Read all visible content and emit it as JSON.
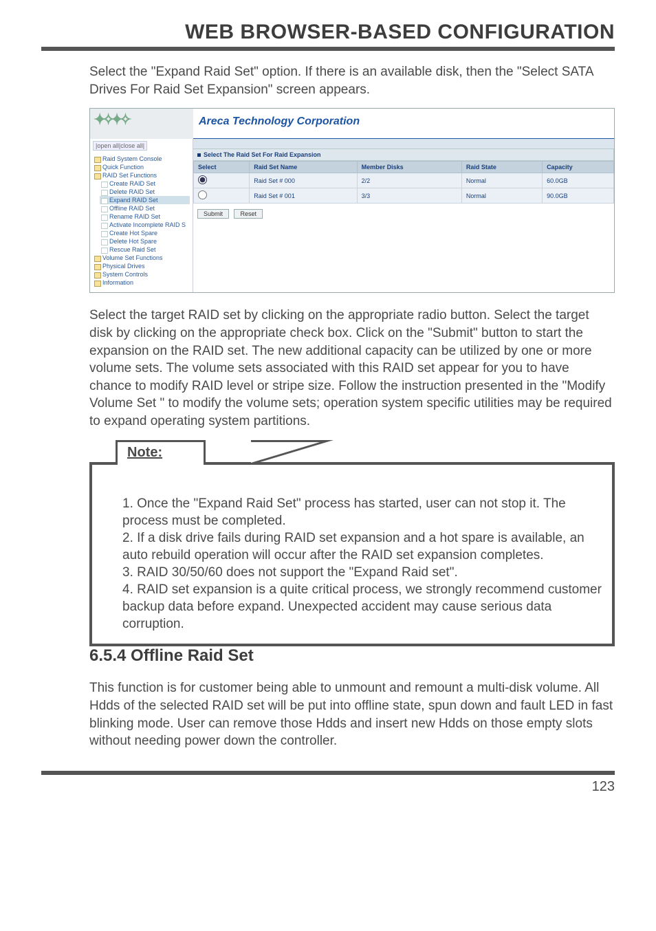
{
  "page_title": "WEB BROWSER-BASED CONFIGURATION",
  "intro_para": "Select the \"Expand Raid Set\" option. If there is an available disk, then the \"Select SATA Drives For Raid Set Expansion\" screen appears.",
  "screenshot": {
    "corp": "Areca Technology Corporation",
    "side_control": "|open all|close all|",
    "tree": {
      "root": "Raid System Console",
      "items": [
        {
          "label": "Quick Function",
          "type": "folder"
        },
        {
          "label": "RAID Set Functions",
          "type": "folder",
          "children": [
            {
              "label": "Create RAID Set",
              "type": "page"
            },
            {
              "label": "Delete RAID Set",
              "type": "page"
            },
            {
              "label": "Expand RAID Set",
              "type": "page",
              "highlight": true
            },
            {
              "label": "Offline RAID Set",
              "type": "page"
            },
            {
              "label": "Rename RAID Set",
              "type": "page"
            },
            {
              "label": "Activate Incomplete RAID S",
              "type": "page"
            },
            {
              "label": "Create Hot Spare",
              "type": "page"
            },
            {
              "label": "Delete Hot Spare",
              "type": "page"
            },
            {
              "label": "Rescue Raid Set",
              "type": "page"
            }
          ]
        },
        {
          "label": "Volume Set Functions",
          "type": "folder"
        },
        {
          "label": "Physical Drives",
          "type": "folder"
        },
        {
          "label": "System Controls",
          "type": "folder"
        },
        {
          "label": "Information",
          "type": "folder"
        }
      ]
    },
    "panel_title": "Select The Raid Set For Raid Expansion",
    "table": {
      "headers": [
        "Select",
        "Raid Set Name",
        "Member Disks",
        "Raid State",
        "Capacity"
      ],
      "rows": [
        {
          "select": true,
          "name": "Raid Set # 000",
          "disks": "2/2",
          "state": "Normal",
          "cap": "60.0GB"
        },
        {
          "select": false,
          "name": "Raid Set # 001",
          "disks": "3/3",
          "state": "Normal",
          "cap": "90.0GB"
        }
      ]
    },
    "buttons": {
      "submit": "Submit",
      "reset": "Reset"
    }
  },
  "after_para": "Select the target RAID set by clicking on the appropriate radio button. Select the target disk by clicking on the appropriate check box. Click on the \"Submit\" button to start the expansion on the RAID set. The new additional capacity can be utilized by one or more volume sets. The volume sets associated with this RAID set appear for you to have chance to modify RAID level or stripe size. Follow the instruction presented in the \"Modify Volume Set \" to modify the volume sets; operation system specific utilities may be required to expand operating system partitions.",
  "note": {
    "label": "Note:",
    "lines": [
      "1. Once the \"Expand Raid Set\" process has started, user can not stop it. The process must be completed.",
      "2. If a disk drive fails during RAID set expansion and a hot spare is available, an auto rebuild operation will occur after the RAID set expansion completes.",
      "3. RAID 30/50/60 does not support the \"Expand Raid set\".",
      "4. RAID set expansion is a quite critical process, we strongly recommend customer backup data before expand. Unexpected accident may cause serious data corruption."
    ]
  },
  "section_heading": "6.5.4 Offline Raid Set",
  "section_para": "This function is for customer being able to unmount and remount a multi-disk volume. All Hdds of the selected RAID set will be put into offline state, spun down and fault LED in fast blinking mode. User can remove those Hdds and insert new Hdds on those empty slots without needing power down the controller.",
  "page_number": "123"
}
